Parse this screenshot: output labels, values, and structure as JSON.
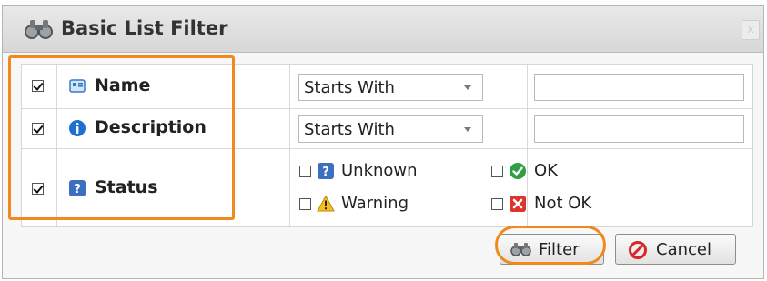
{
  "dialog": {
    "title": "Basic List Filter",
    "close_label": "x"
  },
  "rows": [
    {
      "field": "Name",
      "icon": "name-field-icon",
      "checked": true,
      "operator": "Starts With",
      "value": ""
    },
    {
      "field": "Description",
      "icon": "info-icon",
      "checked": true,
      "operator": "Starts With",
      "value": ""
    },
    {
      "field": "Status",
      "icon": "question-icon",
      "checked": true,
      "options": [
        {
          "label": "Unknown",
          "icon": "question-icon",
          "checked": false
        },
        {
          "label": "OK",
          "icon": "check-circle-icon",
          "checked": false
        },
        {
          "label": "Warning",
          "icon": "warning-icon",
          "checked": false
        },
        {
          "label": "Not OK",
          "icon": "error-icon",
          "checked": false
        }
      ]
    }
  ],
  "buttons": {
    "filter_label": "Filter",
    "cancel_label": "Cancel"
  },
  "colors": {
    "highlight": "#f08a1d",
    "info_blue": "#1e6fd0",
    "ok_green": "#2ea043",
    "error_red": "#e0332b",
    "warning_yellow": "#f6c21a"
  }
}
